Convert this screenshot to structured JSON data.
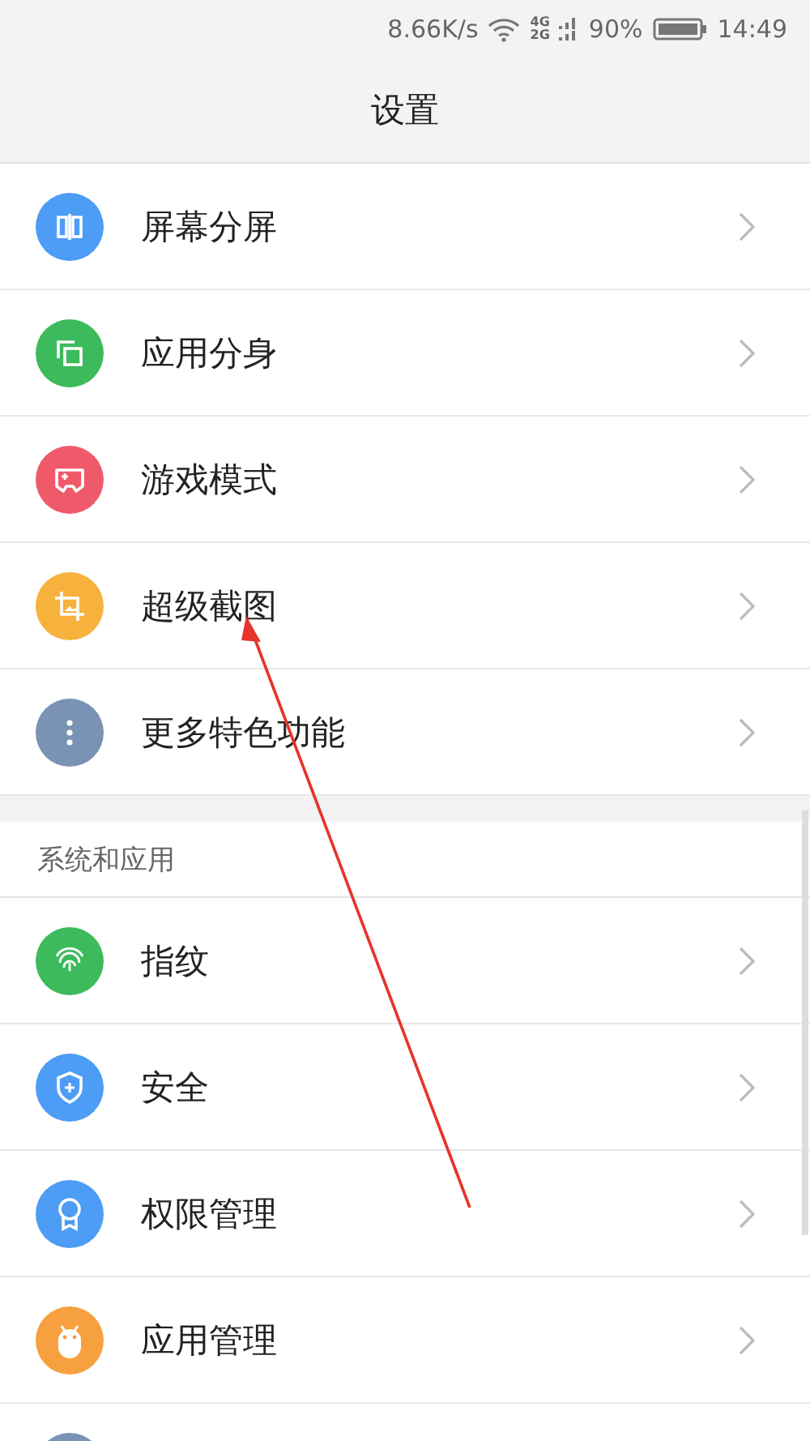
{
  "status_bar": {
    "speed": "8.66K/s",
    "network_top": "4G",
    "network_bottom": "2G",
    "battery": "90%",
    "time": "14:49"
  },
  "header": {
    "title": "设置"
  },
  "groups": [
    {
      "items": [
        {
          "label": "屏幕分屏",
          "color": "#4d9cf5"
        },
        {
          "label": "应用分身",
          "color": "#3dba5c"
        },
        {
          "label": "游戏模式",
          "color": "#ef5a6a"
        },
        {
          "label": "超级截图",
          "color": "#f6b23d"
        },
        {
          "label": "更多特色功能",
          "color": "#7a92b4"
        }
      ]
    },
    {
      "title": "系统和应用",
      "items": [
        {
          "label": "指纹",
          "color": "#3dba5c"
        },
        {
          "label": "安全",
          "color": "#4d9cf5"
        },
        {
          "label": "权限管理",
          "color": "#4d9cf5"
        },
        {
          "label": "应用管理",
          "color": "#f7a040"
        },
        {
          "color": "#7a92b4"
        }
      ]
    }
  ]
}
